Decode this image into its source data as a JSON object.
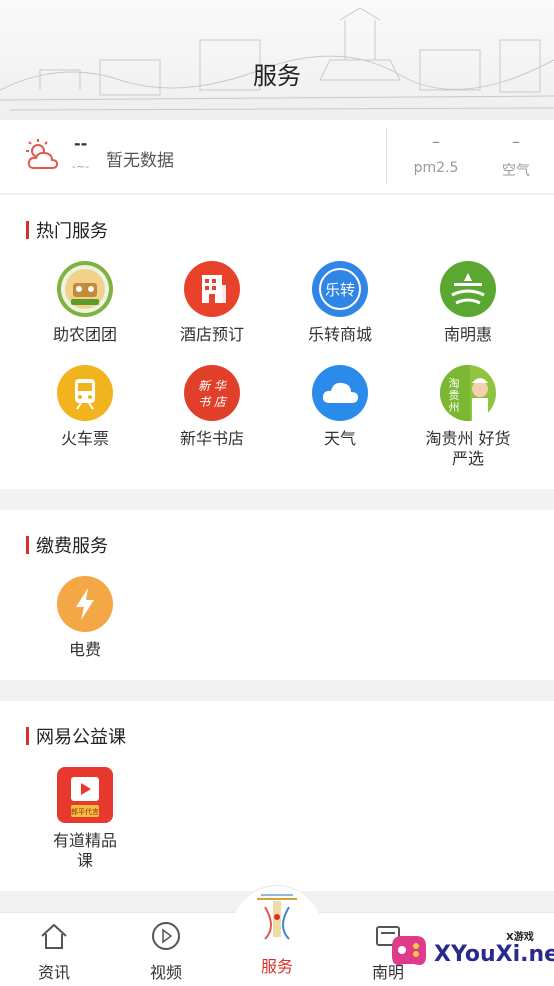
{
  "header": {
    "title": "服务"
  },
  "weather": {
    "temperature": "--",
    "temp_sub": "-~-",
    "status": "暂无数据",
    "pm25_value": "–",
    "pm25_label": "pm2.5",
    "air_value": "–",
    "air_label": "空气"
  },
  "hot_services": {
    "title": "热门服务",
    "items": [
      {
        "label": "助农团团",
        "icon": "farm-group-icon"
      },
      {
        "label": "酒店预订",
        "icon": "hotel-icon"
      },
      {
        "label": "乐转商城",
        "icon": "mall-icon",
        "icon_text": "乐转"
      },
      {
        "label": "南明惠",
        "icon": "nanming-icon"
      },
      {
        "label": "火车票",
        "icon": "train-icon"
      },
      {
        "label": "新华书店",
        "icon": "bookstore-icon",
        "icon_text": "新华书店"
      },
      {
        "label": "天气",
        "icon": "cloud-icon"
      },
      {
        "label": "淘贵州 好货严选",
        "icon": "taoguizhou-icon",
        "icon_text": "淘贵州"
      }
    ]
  },
  "payment_services": {
    "title": "缴费服务",
    "items": [
      {
        "label": "电费",
        "icon": "lightning-icon"
      }
    ]
  },
  "netease_courses": {
    "title": "网易公益课",
    "items": [
      {
        "label": "有道精品课",
        "icon": "youdao-icon",
        "icon_text": "郎平代言"
      }
    ]
  },
  "tabbar": {
    "tabs": [
      {
        "label": "资讯",
        "icon": "home-icon"
      },
      {
        "label": "视频",
        "icon": "play-icon"
      },
      {
        "label": "服务",
        "icon": "service-emblem-icon",
        "active": true
      },
      {
        "label": "南明",
        "icon": "nanming-tab-icon"
      }
    ]
  },
  "watermark": {
    "brand": "XYouXi.net",
    "small": "X游戏"
  },
  "colors": {
    "accent": "#d9302b",
    "divider_bar": "#d9302b"
  }
}
